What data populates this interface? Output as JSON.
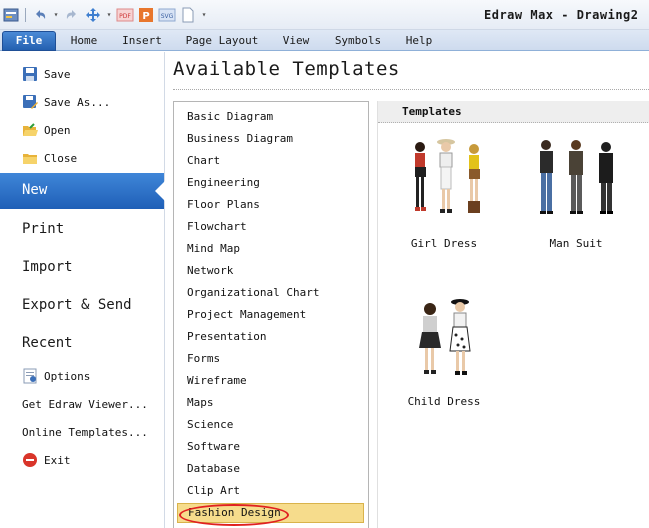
{
  "window_title": "Edraw Max - Drawing2",
  "quick_access": [
    {
      "name": "app-icon",
      "glyph": "▤"
    },
    {
      "name": "undo-icon",
      "glyph": "↶"
    },
    {
      "name": "dropdown-icon",
      "glyph": "▾"
    },
    {
      "name": "redo-icon",
      "glyph": "↷"
    },
    {
      "name": "move-icon",
      "glyph": "✥"
    },
    {
      "name": "pdf-icon",
      "glyph": "PDF"
    },
    {
      "name": "ppt-icon",
      "glyph": "P"
    },
    {
      "name": "svg-icon",
      "glyph": "SVG"
    },
    {
      "name": "new-page-icon",
      "glyph": "▯"
    }
  ],
  "tabs": [
    "File",
    "Home",
    "Insert",
    "Page Layout",
    "View",
    "Symbols",
    "Help"
  ],
  "nav": {
    "save": "Save",
    "save_as": "Save As...",
    "open": "Open",
    "close": "Close",
    "new": "New",
    "print": "Print",
    "import": "Import",
    "export": "Export & Send",
    "recent": "Recent",
    "options": "Options",
    "viewer": "Get Edraw Viewer...",
    "online": "Online Templates...",
    "exit": "Exit"
  },
  "heading": "Available Templates",
  "categories": [
    "Basic Diagram",
    "Business Diagram",
    "Chart",
    "Engineering",
    "Floor Plans",
    "Flowchart",
    "Mind Map",
    "Network",
    "Organizational Chart",
    "Project Management",
    "Presentation",
    "Forms",
    "Wireframe",
    "Maps",
    "Science",
    "Software",
    "Database",
    "Clip Art",
    "Fashion Design"
  ],
  "selected_category": "Fashion Design",
  "templates_header": "Templates",
  "templates": [
    {
      "label": "Girl Dress"
    },
    {
      "label": "Man Suit"
    },
    {
      "label": "Child Dress"
    }
  ],
  "colors": {
    "accent": "#2a6fc6",
    "selection": "#f6dc8c",
    "highlight_ring": "#e02020"
  }
}
